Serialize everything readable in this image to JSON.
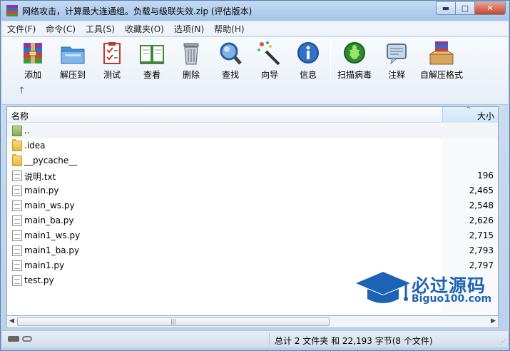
{
  "window": {
    "title": "网络攻击，计算最大连通组。负载与级联失效.zip (评估版本)",
    "min_label": "▬",
    "max_label": "□",
    "close_label": "✕"
  },
  "menu": [
    "文件(F)",
    "命令(C)",
    "工具(S)",
    "收藏夹(O)",
    "选项(N)",
    "帮助(H)"
  ],
  "toolbar": {
    "buttons": [
      {
        "label": "添加",
        "icon": "add-archive-icon"
      },
      {
        "label": "解压到",
        "icon": "extract-folder-icon"
      },
      {
        "label": "测试",
        "icon": "test-checklist-icon"
      },
      {
        "label": "查看",
        "icon": "view-book-icon"
      },
      {
        "label": "删除",
        "icon": "delete-trash-icon"
      },
      {
        "label": "查找",
        "icon": "find-magnifier-icon"
      },
      {
        "label": "向导",
        "icon": "wizard-wand-icon"
      },
      {
        "label": "信息",
        "icon": "info-icon"
      },
      {
        "label": "扫描病毒",
        "icon": "virus-scan-icon"
      },
      {
        "label": "注释",
        "icon": "comment-icon"
      },
      {
        "label": "自解压格式",
        "icon": "sfx-archive-icon"
      }
    ],
    "up_label": "↑"
  },
  "list": {
    "col_name": "名称",
    "col_size": "大小",
    "sort_glyph": "^",
    "rows": [
      {
        "name": "..",
        "size": "",
        "type": "up"
      },
      {
        "name": ".idea",
        "size": "",
        "type": "folder"
      },
      {
        "name": "__pycache__",
        "size": "",
        "type": "folder"
      },
      {
        "name": "说明.txt",
        "size": "196",
        "type": "file"
      },
      {
        "name": "main.py",
        "size": "2,465",
        "type": "file"
      },
      {
        "name": "main_ws.py",
        "size": "2,548",
        "type": "file"
      },
      {
        "name": "main_ba.py",
        "size": "2,626",
        "type": "file"
      },
      {
        "name": "main1_ws.py",
        "size": "2,715",
        "type": "file"
      },
      {
        "name": "main1_ba.py",
        "size": "2,793",
        "type": "file"
      },
      {
        "name": "main1.py",
        "size": "2,797",
        "type": "file"
      },
      {
        "name": "test.py",
        "size": "",
        "type": "file"
      }
    ]
  },
  "scroll": {
    "left": "◀",
    "right": "▶",
    "grip": "|||"
  },
  "status": {
    "summary": "总计 2 文件夹 和 22,193 字节(8 个文件)"
  },
  "watermark": {
    "title": "必过源码",
    "subtitle": "Biguo100.com"
  },
  "colors": {
    "accent": "#1d62b5",
    "title_bar": "#a6c4e8",
    "close_button": "#c6442b"
  }
}
